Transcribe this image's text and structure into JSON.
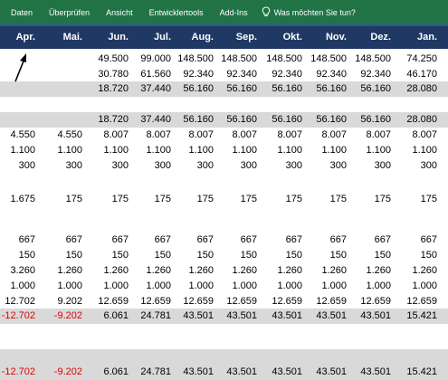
{
  "ribbon": {
    "tabs": [
      "Daten",
      "Überprüfen",
      "Ansicht",
      "Entwicklertools",
      "Add-Ins"
    ],
    "search_icon": "lightbulb-icon",
    "search_label": "Was möchten Sie tun?"
  },
  "columns": [
    "Apr.",
    "Mai.",
    "Jun.",
    "Jul.",
    "Aug.",
    "Sep.",
    "Okt.",
    "Nov.",
    "Dez.",
    "Jan."
  ],
  "rows": [
    {
      "gray": false,
      "cells": [
        "",
        "",
        "49.500",
        "99.000",
        "148.500",
        "148.500",
        "148.500",
        "148.500",
        "148.500",
        "74.250"
      ]
    },
    {
      "gray": false,
      "cells": [
        "",
        "",
        "30.780",
        "61.560",
        "92.340",
        "92.340",
        "92.340",
        "92.340",
        "92.340",
        "46.170"
      ]
    },
    {
      "gray": true,
      "cells": [
        "",
        "",
        "18.720",
        "37.440",
        "56.160",
        "56.160",
        "56.160",
        "56.160",
        "56.160",
        "28.080"
      ]
    },
    {
      "gray": false,
      "cells": [
        "",
        "",
        "",
        "",
        "",
        "",
        "",
        "",
        "",
        ""
      ]
    },
    {
      "gray": true,
      "cells": [
        "",
        "",
        "18.720",
        "37.440",
        "56.160",
        "56.160",
        "56.160",
        "56.160",
        "56.160",
        "28.080"
      ]
    },
    {
      "gray": false,
      "cells": [
        "4.550",
        "4.550",
        "8.007",
        "8.007",
        "8.007",
        "8.007",
        "8.007",
        "8.007",
        "8.007",
        "8.007"
      ]
    },
    {
      "gray": false,
      "cells": [
        "1.100",
        "1.100",
        "1.100",
        "1.100",
        "1.100",
        "1.100",
        "1.100",
        "1.100",
        "1.100",
        "1.100"
      ]
    },
    {
      "gray": false,
      "cells": [
        "300",
        "300",
        "300",
        "300",
        "300",
        "300",
        "300",
        "300",
        "300",
        "300"
      ]
    },
    {
      "gray": false,
      "cells": [
        "",
        "",
        "",
        "",
        "",
        "",
        "",
        "",
        "",
        ""
      ]
    },
    {
      "gray": false,
      "cells": [
        "1.675",
        "175",
        "175",
        "175",
        "175",
        "175",
        "175",
        "175",
        "175",
        "175"
      ]
    },
    {
      "gray": false,
      "cells": [
        "",
        "",
        "",
        "",
        "",
        "",
        "",
        "",
        "",
        ""
      ]
    },
    {
      "gray": false,
      "cells": [
        "667",
        "667",
        "667",
        "667",
        "667",
        "667",
        "667",
        "667",
        "667",
        "667"
      ]
    },
    {
      "gray": false,
      "cells": [
        "150",
        "150",
        "150",
        "150",
        "150",
        "150",
        "150",
        "150",
        "150",
        "150"
      ]
    },
    {
      "gray": false,
      "cells": [
        "3.260",
        "1.260",
        "1.260",
        "1.260",
        "1.260",
        "1.260",
        "1.260",
        "1.260",
        "1.260",
        "1.260"
      ]
    },
    {
      "gray": false,
      "cells": [
        "1.000",
        "1.000",
        "1.000",
        "1.000",
        "1.000",
        "1.000",
        "1.000",
        "1.000",
        "1.000",
        "1.000"
      ]
    },
    {
      "gray": false,
      "cells": [
        "12.702",
        "9.202",
        "12.659",
        "12.659",
        "12.659",
        "12.659",
        "12.659",
        "12.659",
        "12.659",
        "12.659"
      ]
    },
    {
      "gray": true,
      "cells": [
        "-12.702",
        "-9.202",
        "6.061",
        "24.781",
        "43.501",
        "43.501",
        "43.501",
        "43.501",
        "43.501",
        "15.421"
      ]
    },
    {
      "gray": false,
      "cells": [
        "",
        "",
        "",
        "",
        "",
        "",
        "",
        "",
        "",
        ""
      ]
    },
    {
      "gray": false,
      "cells": [
        "",
        "",
        "",
        "",
        "",
        "",
        "",
        "",
        "",
        ""
      ]
    },
    {
      "gray": true,
      "cells": [
        "",
        "",
        "",
        "",
        "",
        "",
        "",
        "",
        "",
        ""
      ]
    },
    {
      "gray": true,
      "cells": [
        "-12.702",
        "-9.202",
        "6.061",
        "24.781",
        "43.501",
        "43.501",
        "43.501",
        "43.501",
        "43.501",
        "15.421"
      ]
    }
  ],
  "colors": {
    "ribbon": "#217346",
    "header": "#203864",
    "gray_row": "#d9d9d9",
    "negative": "#e00000"
  },
  "annotation_icon": "arrow-icon"
}
